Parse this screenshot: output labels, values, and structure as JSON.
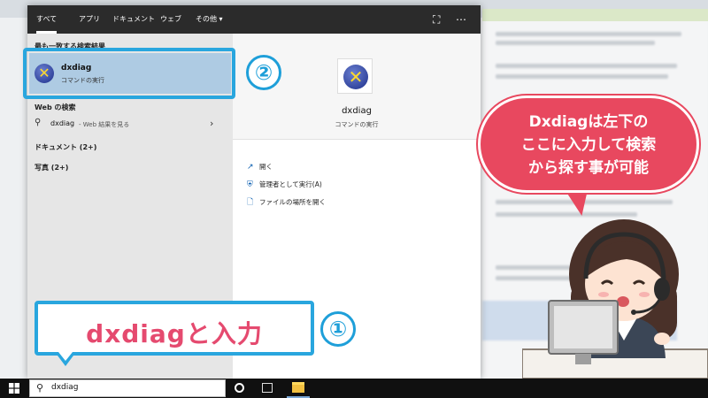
{
  "tabs": [
    "すべて",
    "アプリ",
    "ドキュメント",
    "ウェブ",
    "その他 ▾"
  ],
  "left": {
    "best_match_heading": "最も一致する検索結果",
    "best": {
      "title": "dxdiag",
      "subtitle": "コマンドの実行"
    },
    "web_heading": "Web の検索",
    "web_item": "dxdiag",
    "web_item_suffix": " - Web 結果を見る",
    "docs_heading": "ドキュメント (2+)",
    "photos_heading": "写真 (2+)"
  },
  "right": {
    "title": "dxdiag",
    "subtitle": "コマンドの実行",
    "actions": [
      "開く",
      "管理者として実行(A)",
      "ファイルの場所を開く"
    ]
  },
  "annotations": {
    "step1_number": "①",
    "step2_number": "②",
    "callout_text": "dxdiagと入力",
    "bubble_lines": [
      "Dxdiagは左下の",
      "ここに入力して検索",
      "から探す事が可能"
    ]
  },
  "taskbar": {
    "search_value": "dxdiag",
    "windows_icon": "windows-logo-icon",
    "cortana_icon": "cortana-circle-icon",
    "taskview_icon": "task-view-icon",
    "explorer_icon": "file-explorer-icon"
  },
  "colors": {
    "accent_blue": "#29a6de",
    "selected_row": "#aecbe3",
    "callout_text": "#e54a6f",
    "bubble": "#e8485f",
    "tabbar": "#2b2b2b"
  }
}
